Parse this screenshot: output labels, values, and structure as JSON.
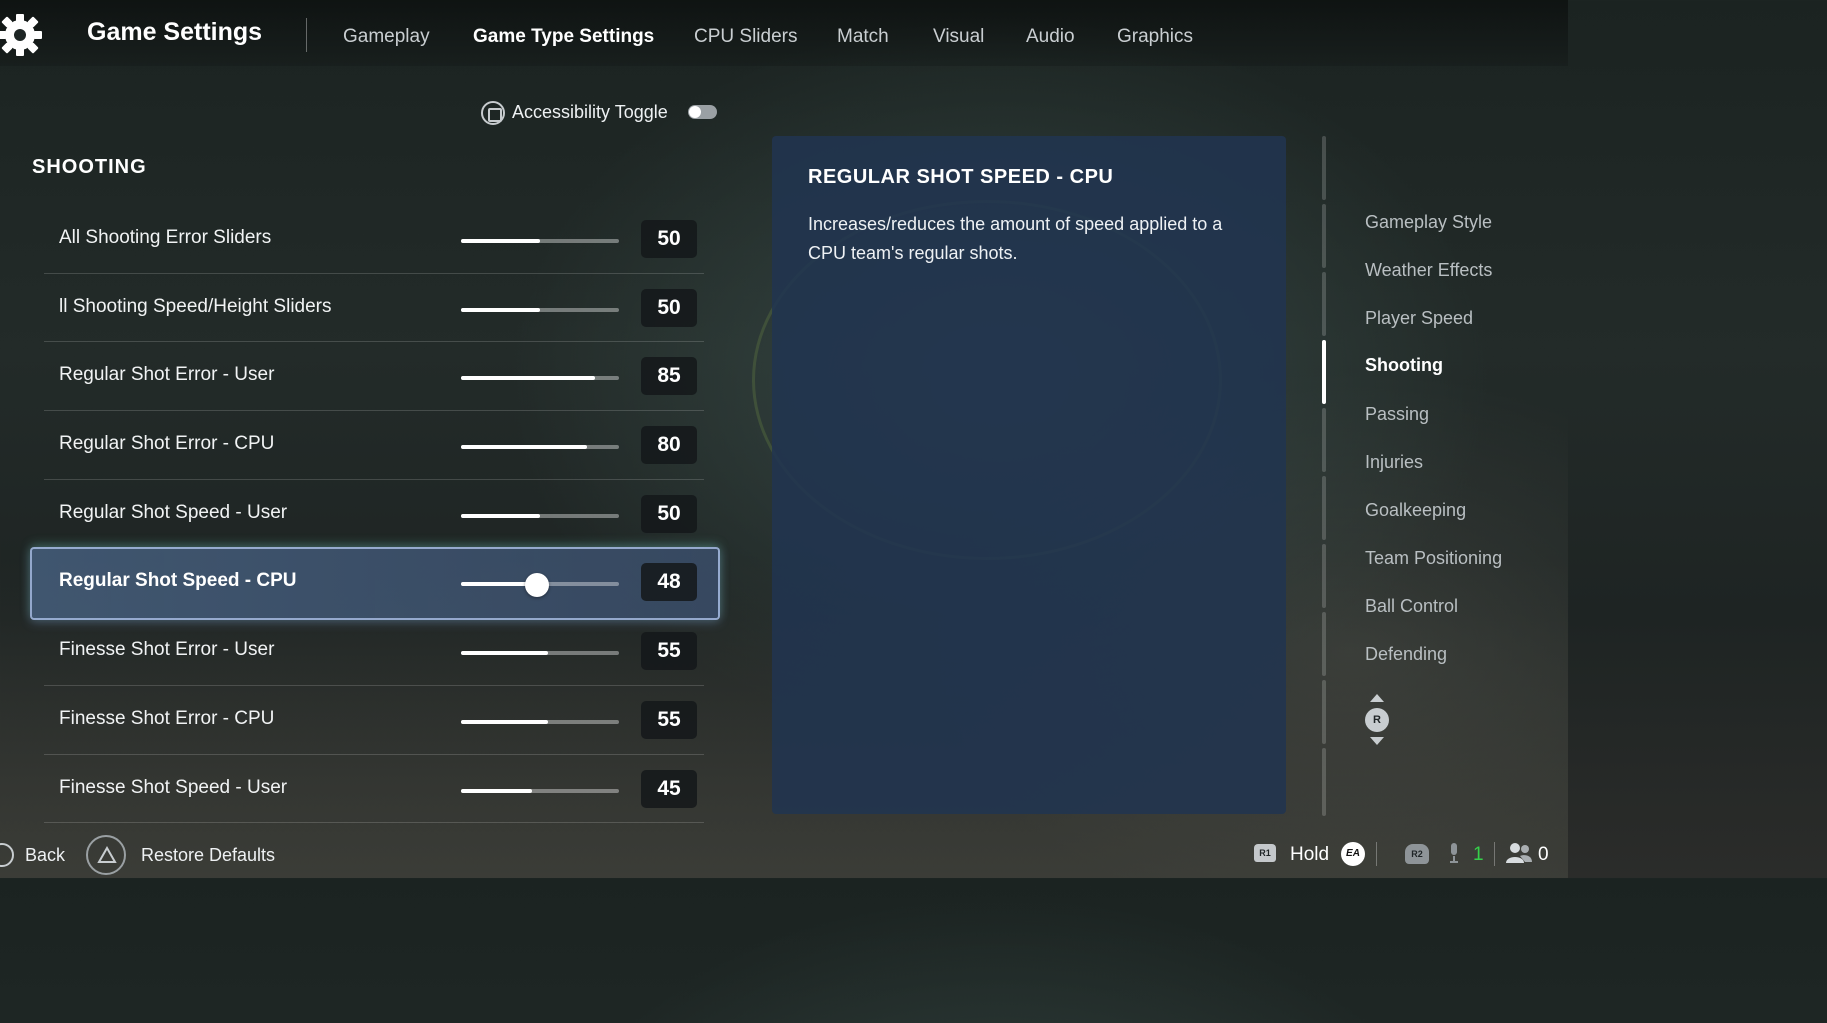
{
  "header": {
    "title": "Game Settings",
    "tabs": [
      {
        "label": "Gameplay",
        "active": false
      },
      {
        "label": "Game Type Settings",
        "active": true
      },
      {
        "label": "CPU Sliders",
        "active": false
      },
      {
        "label": "Match",
        "active": false
      },
      {
        "label": "Visual",
        "active": false
      },
      {
        "label": "Audio",
        "active": false
      },
      {
        "label": "Graphics",
        "active": false
      }
    ]
  },
  "accessibility": {
    "label": "Accessibility Toggle",
    "enabled": false,
    "icon": "square-button-icon"
  },
  "section": {
    "title": "SHOOTING",
    "sliders": [
      {
        "label": "All Shooting Error Sliders",
        "value": "50",
        "max": 100
      },
      {
        "label": "ll Shooting Speed/Height Sliders",
        "value": "50",
        "max": 100
      },
      {
        "label": "Regular Shot Error - User",
        "value": "85",
        "max": 100
      },
      {
        "label": "Regular Shot Error - CPU",
        "value": "80",
        "max": 100
      },
      {
        "label": "Regular Shot Speed - User",
        "value": "50",
        "max": 100
      },
      {
        "label": "Regular Shot Speed - CPU",
        "value": "48",
        "max": 100,
        "selected": true
      },
      {
        "label": "Finesse Shot Error - User",
        "value": "55",
        "max": 100
      },
      {
        "label": "Finesse Shot Error - CPU",
        "value": "55",
        "max": 100
      },
      {
        "label": "Finesse Shot Speed - User",
        "value": "45",
        "max": 100
      }
    ]
  },
  "description": {
    "title": "REGULAR SHOT SPEED - CPU",
    "text": "Increases/reduces the amount of speed applied to a CPU team's regular shots."
  },
  "side_nav": {
    "items": [
      {
        "label": "Gameplay Style",
        "active": false
      },
      {
        "label": "Weather Effects",
        "active": false
      },
      {
        "label": "Player Speed",
        "active": false
      },
      {
        "label": "Shooting",
        "active": true
      },
      {
        "label": "Passing",
        "active": false
      },
      {
        "label": "Injuries",
        "active": false
      },
      {
        "label": "Goalkeeping",
        "active": false
      },
      {
        "label": "Team Positioning",
        "active": false
      },
      {
        "label": "Ball Control",
        "active": false
      },
      {
        "label": "Defending",
        "active": false
      }
    ],
    "scroll_hint_button": "R"
  },
  "footer": {
    "back_label": "Back",
    "restore_label": "Restore Defaults",
    "r1_label": "R1",
    "hold_label": "Hold",
    "ea_label": "EA",
    "r2_label": "R2",
    "mic_count": "1",
    "friends_count": "0"
  },
  "colors": {
    "panel": "#213450",
    "selected_row": "#46607d",
    "mic_green": "#35d04a"
  }
}
